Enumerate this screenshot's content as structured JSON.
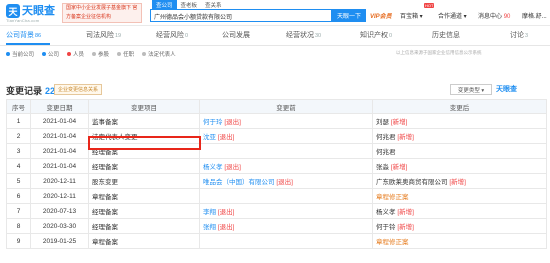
{
  "header": {
    "logo_glyph": "天",
    "logo_text": "天眼查",
    "logo_sub": "TianYanCha.com",
    "promo": "国家中小企业发展子基金旗下 官方备案企业征信机构",
    "search_tabs": [
      "查公司",
      "查老板",
      "查关系"
    ],
    "search_value": "广州德品会小额贷款有限公司",
    "search_button": "天眼一下",
    "vip_label": "VIP会员",
    "nav_baibao": "百宝箱",
    "hot_badge": "HOT",
    "nav_cooperation": "合作通道",
    "nav_messages": "消息中心",
    "messages_count": "90",
    "user_name": "摩格.舒..."
  },
  "dim_tabs": [
    {
      "label": "公司背景",
      "count": "86",
      "active": true
    },
    {
      "label": "司法风险",
      "count": "19",
      "active": false
    },
    {
      "label": "经营风险",
      "count": "0",
      "active": false
    },
    {
      "label": "公司发展",
      "count": "",
      "active": false
    },
    {
      "label": "经营状况",
      "count": "30",
      "active": false
    },
    {
      "label": "知识产权",
      "count": "0",
      "active": false
    },
    {
      "label": "历史信息",
      "count": "",
      "active": false
    },
    {
      "label": "讨论",
      "count": "3",
      "active": false
    }
  ],
  "legend": [
    {
      "label": "当前公司",
      "color": "#1f8ef1"
    },
    {
      "label": "公司",
      "color": "#1f8ef1"
    },
    {
      "label": "人员",
      "color": "#f04444"
    },
    {
      "label": "参股",
      "color": "#bbbbbb"
    },
    {
      "label": "任职",
      "color": "#bbbbbb"
    },
    {
      "label": "法定代表人",
      "color": "#bbbbbb"
    }
  ],
  "right_note": "以上信息来源于国家企业信用信息公示系统",
  "section": {
    "title": "变更记录",
    "count": "22",
    "tag": "企业变更信息关系",
    "type_button": "变更类型 ▾",
    "watermark": "天眼查"
  },
  "table": {
    "headers": [
      "序号",
      "变更日期",
      "变更项目",
      "变更前",
      "变更后"
    ],
    "rows": [
      {
        "idx": "1",
        "date": "2021-01-04",
        "item": "监事备案",
        "before_name": "何于玲",
        "before_tag": "[退出]",
        "after_name": "刘瑟",
        "after_tag": "[新增]"
      },
      {
        "idx": "2",
        "date": "2021-01-04",
        "item": "法定代表人变更",
        "before_name": "沈亚",
        "before_tag": "[退出]",
        "after_name": "何兆君",
        "after_tag": "[新增]"
      },
      {
        "idx": "3",
        "date": "2021-01-04",
        "item": "经理备案",
        "before_name": "",
        "before_tag": "",
        "after_name": "何兆君",
        "after_tag": ""
      },
      {
        "idx": "4",
        "date": "2021-01-04",
        "item": "经理备案",
        "before_name": "杨义孝",
        "before_tag": "[退出]",
        "after_name": "张淼",
        "after_tag": "[新增]"
      },
      {
        "idx": "5",
        "date": "2020-12-11",
        "item": "股东变更",
        "before_name": "唯品会（中国）有限公司",
        "before_tag": "[退出]",
        "after_name": "广东欧莱奥商贸有限公司",
        "after_tag": "[新增]"
      },
      {
        "idx": "6",
        "date": "2020-12-11",
        "item": "章程备案",
        "before_name": "",
        "before_tag": "",
        "after_name": "章程修正案",
        "after_tag": ""
      },
      {
        "idx": "7",
        "date": "2020-07-13",
        "item": "经理备案",
        "before_name": "李翔",
        "before_tag": "[退出]",
        "after_name": "杨义孝",
        "after_tag": "[新增]"
      },
      {
        "idx": "8",
        "date": "2020-03-30",
        "item": "经理备案",
        "before_name": "张翔",
        "before_tag": "[退出]",
        "after_name": "何于铃",
        "after_tag": "[新增]"
      },
      {
        "idx": "9",
        "date": "2019-01-25",
        "item": "章程备案",
        "before_name": "",
        "before_tag": "",
        "after_name": "章程修正案",
        "after_tag": ""
      }
    ]
  },
  "colors": {
    "accent": "#1f8ef1",
    "added": "#f04444",
    "highlight": "#e8261a"
  }
}
